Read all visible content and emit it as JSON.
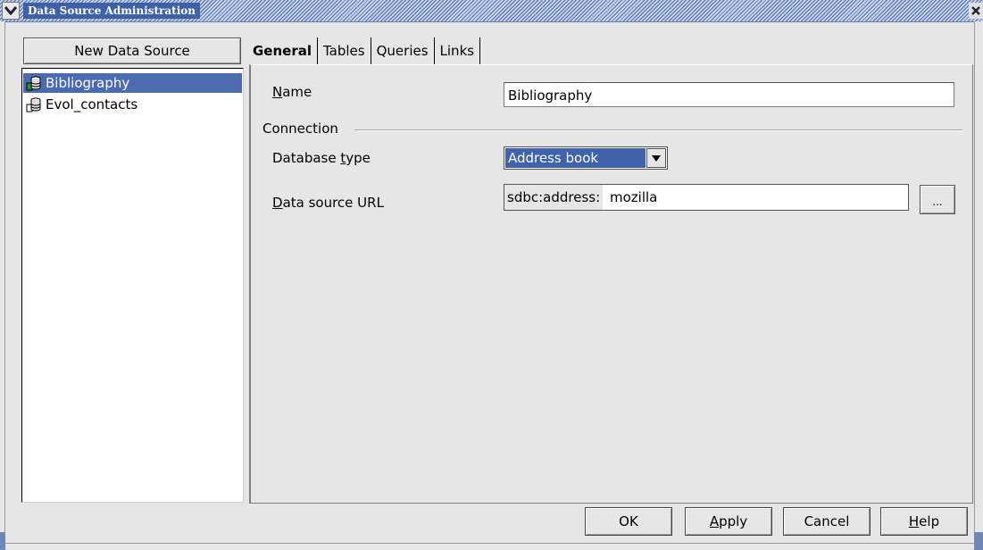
{
  "window": {
    "title": "Data Source Administration"
  },
  "sidebar": {
    "new_button_label": "New Data Source",
    "items": [
      {
        "label": "Bibliography",
        "selected": true
      },
      {
        "label": "Evol_contacts",
        "selected": false
      }
    ]
  },
  "tabs": [
    {
      "label": "General",
      "active": true
    },
    {
      "label": "Tables",
      "active": false
    },
    {
      "label": "Queries",
      "active": false
    },
    {
      "label": "Links",
      "active": false
    }
  ],
  "general": {
    "name_label_u": "N",
    "name_label_rest": "ame",
    "name_value": "Bibliography",
    "connection_label": "Connection",
    "db_type_label_pre": "Database ",
    "db_type_label_u": "t",
    "db_type_label_post": "ype",
    "db_type_value": "Address book",
    "url_label_u": "D",
    "url_label_rest": "ata source URL",
    "url_prefix": "sdbc:address:",
    "url_value": "mozilla",
    "browse_label": "..."
  },
  "footer": {
    "ok_label": "OK",
    "apply_u": "A",
    "apply_rest": "pply",
    "cancel_label": "Cancel",
    "help_u": "H",
    "help_rest": "elp"
  },
  "colors": {
    "selection": "#4b6aaf",
    "title_bar": "#3d60a8",
    "dialog_bg": "#e6e6e6"
  }
}
